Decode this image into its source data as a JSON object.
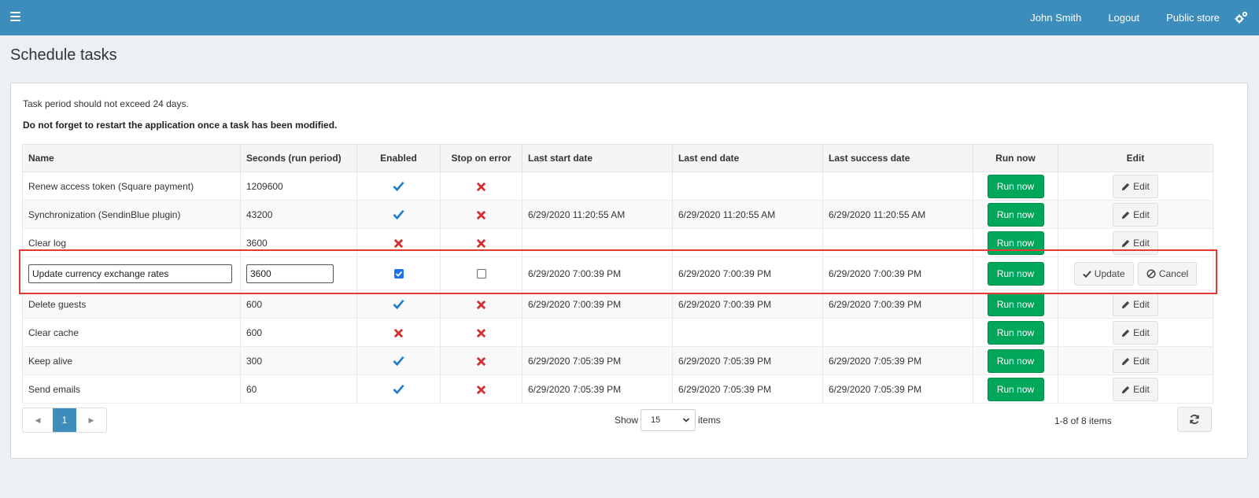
{
  "topbar": {
    "user": "John Smith",
    "logout": "Logout",
    "public_store": "Public store"
  },
  "page": {
    "title": "Schedule tasks",
    "note1": "Task period should not exceed 24 days.",
    "note2": "Do not forget to restart the application once a task has been modified."
  },
  "table": {
    "columns": [
      "Name",
      "Seconds (run period)",
      "Enabled",
      "Stop on error",
      "Last start date",
      "Last end date",
      "Last success date",
      "Run now",
      "Edit"
    ],
    "run_label": "Run now",
    "edit_label": "Edit",
    "rows": [
      {
        "name": "Renew access token (Square payment)",
        "seconds": "1209600",
        "enabled": true,
        "stop_on_error": false,
        "last_start": "",
        "last_end": "",
        "last_success": ""
      },
      {
        "name": "Synchronization (SendinBlue plugin)",
        "seconds": "43200",
        "enabled": true,
        "stop_on_error": false,
        "last_start": "6/29/2020 11:20:55 AM",
        "last_end": "6/29/2020 11:20:55 AM",
        "last_success": "6/29/2020 11:20:55 AM"
      },
      {
        "name": "Clear log",
        "seconds": "3600",
        "enabled": false,
        "stop_on_error": false,
        "last_start": "",
        "last_end": "",
        "last_success": ""
      },
      {
        "name": "Update currency exchange rates",
        "seconds": "3600",
        "enabled": true,
        "stop_on_error": false,
        "last_start": "6/29/2020 7:00:39 PM",
        "last_end": "6/29/2020 7:00:39 PM",
        "last_success": "6/29/2020 7:00:39 PM",
        "editing": true
      },
      {
        "name": "Delete guests",
        "seconds": "600",
        "enabled": true,
        "stop_on_error": false,
        "last_start": "6/29/2020 7:00:39 PM",
        "last_end": "6/29/2020 7:00:39 PM",
        "last_success": "6/29/2020 7:00:39 PM"
      },
      {
        "name": "Clear cache",
        "seconds": "600",
        "enabled": false,
        "stop_on_error": false,
        "last_start": "",
        "last_end": "",
        "last_success": ""
      },
      {
        "name": "Keep alive",
        "seconds": "300",
        "enabled": true,
        "stop_on_error": false,
        "last_start": "6/29/2020 7:05:39 PM",
        "last_end": "6/29/2020 7:05:39 PM",
        "last_success": "6/29/2020 7:05:39 PM"
      },
      {
        "name": "Send emails",
        "seconds": "60",
        "enabled": true,
        "stop_on_error": false,
        "last_start": "6/29/2020 7:05:39 PM",
        "last_end": "6/29/2020 7:05:39 PM",
        "last_success": "6/29/2020 7:05:39 PM"
      }
    ],
    "update_label": "Update",
    "cancel_label": "Cancel"
  },
  "footer": {
    "current_page": "1",
    "show_label": "Show",
    "page_size": "15",
    "items_label": "items",
    "count_text": "1-8 of 8 items"
  },
  "colors": {
    "header": "#3c8dbc",
    "run_button": "#00a65a",
    "check": "#1e7ccb",
    "cross": "#d32f2f",
    "highlight": "#e53935"
  }
}
